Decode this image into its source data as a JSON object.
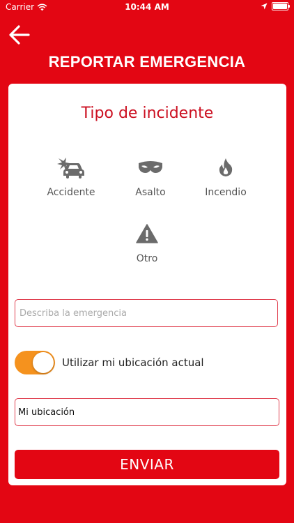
{
  "status_bar": {
    "carrier": "Carrier",
    "time": "10:44 AM",
    "icons": [
      "wifi-icon",
      "location-arrow-icon",
      "battery-icon"
    ]
  },
  "header": {
    "back_icon": "arrow-left-icon",
    "title": "REPORTAR EMERGENCIA"
  },
  "card": {
    "title": "Tipo de incidente",
    "incident_types": [
      {
        "label": "Accidente",
        "icon": "car-crash-icon"
      },
      {
        "label": "Asalto",
        "icon": "mask-icon"
      },
      {
        "label": "Incendio",
        "icon": "fire-icon"
      },
      {
        "label": "Otro",
        "icon": "warning-icon"
      }
    ],
    "description": {
      "placeholder": "Describa la emergencia",
      "value": ""
    },
    "use_location": {
      "label": "Utilizar mi ubicación actual",
      "on": true
    },
    "location": {
      "value": "Mi ubicación"
    },
    "submit_label": "ENVIAR"
  },
  "colors": {
    "primary": "#e30613",
    "toggle_on": "#f5921e",
    "title_red": "#cc1122",
    "icon_gray": "#6b6b6b"
  }
}
